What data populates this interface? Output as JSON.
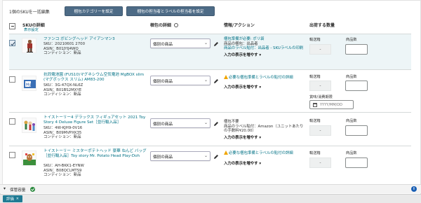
{
  "toolbar": {
    "selection_count": "1個のSKUを一括編集",
    "set_category_label": "梱包カテゴリーを設定",
    "set_packer_label": "梱包の担当者とラベルの担当者を設定"
  },
  "table": {
    "headers": {
      "sku": "SKUの詳細",
      "sku_sub": "表示設定",
      "packing": "梱包の詳細",
      "info": "情報/アクション",
      "qty": "出荷する数量"
    },
    "rows": [
      {
        "checked": true,
        "name": "ファンコ ボビングヘッド アイアンマン3",
        "sku_label": "SKU：",
        "sku": "20210601 2700",
        "asin_label": "ASIN：",
        "asin": "B01JYIJ4WQ",
        "cond_label": "コンディション：",
        "condition": "新品",
        "packing_select": "個別の商品",
        "info_lines": [
          {
            "text": "梱包準備が必要: ポリ袋",
            "style": "link"
          },
          {
            "text": "商品の梱包：出品者",
            "style": ""
          },
          {
            "text": "商品のラベル貼付：出品者 - SKUラベルの印刷",
            "style": "link-mix"
          }
        ],
        "more": "入力の表示を増やす ▾",
        "ship_label": "輸送箱",
        "ship_value": "-",
        "units_label": "商品数"
      },
      {
        "checked": false,
        "name": "抗同電池園 (FUS10)マグネシウム空気電池 MgBOX slim (マグボックス スリム) AM83-200",
        "sku_label": "SKU：",
        "sku": "3G-47QX-NL6Z",
        "asin_label": "ASIN：",
        "asin": "B01BS2MXYE",
        "cond_label": "コンディション：",
        "condition": "新品",
        "packing_select": "個別の商品",
        "warning": "必要な梱包準備とラベルの貼付の詳細",
        "more": "入力の表示を増やす ▾",
        "ship_label": "輸送箱",
        "ship_value": "-",
        "units_label": "商品数",
        "expiry_label": "賞味/消費期限",
        "expiry_placeholder": "YYYY/MM/DD"
      },
      {
        "checked": false,
        "name": "トイストーリー4 デラックス フィギュアセット 2021 Toy Story 4 Deluxe Figure Set［並行輸入品］",
        "sku_label": "SKU：",
        "sku": "4W-KJH9-0V16",
        "asin_label": "ASIN：",
        "asin": "B09MVPXK35",
        "cond_label": "コンディション：",
        "condition": "新品",
        "packing_select": "個別の商品",
        "info_lines": [
          {
            "text": "梱包不要",
            "style": ""
          },
          {
            "text": "商品のラベル貼付：Amazon（ユニットあたりの手数料¥20.00）",
            "style": ""
          }
        ],
        "more": "入力の表示を増やす ▾",
        "ship_label": "輸送箱",
        "ship_value": "-",
        "units_label": "商品数"
      },
      {
        "checked": false,
        "name": "トイストーリー ミスターポテトヘッド 豪華 ねんど バッグ［並行輸入品］Toy story Mr. Potato Head Play-Doh",
        "sku_label": "SKU：",
        "sku": "AH-BKK1-EYNW",
        "asin_label": "ASIN：",
        "asin": "B08QCLMTS9",
        "cond_label": "コンディション：",
        "condition": "新品",
        "packing_select": "個別の商品",
        "warning": "必要な梱包準備とラベルの貼付の詳細",
        "more": "入力の表示を増やす ▾",
        "ship_label": "輸送箱",
        "ship_value": "-",
        "units_label": "商品数"
      }
    ]
  },
  "footer": {
    "save_label": "保管容量",
    "tab_label": "評価",
    "tab_close": "×",
    "info_glyph": "i"
  }
}
